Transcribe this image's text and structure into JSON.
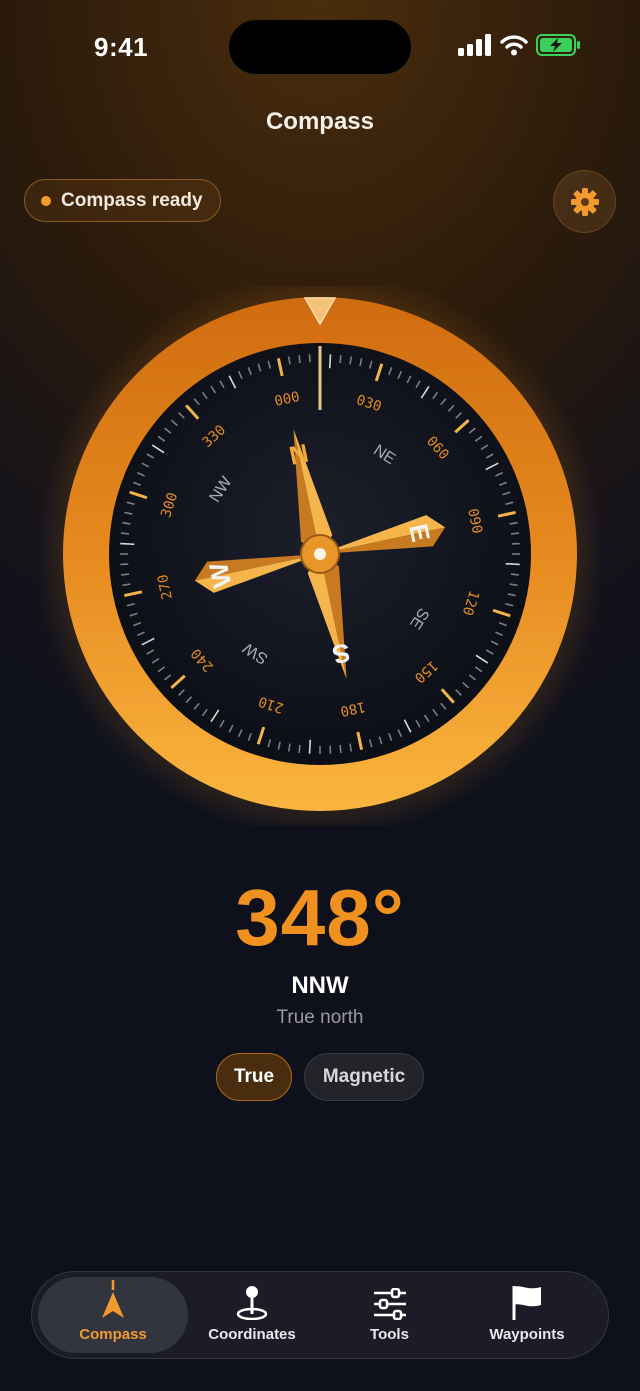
{
  "status_bar": {
    "time": "9:41"
  },
  "header": {
    "title": "Compass"
  },
  "status_pill": {
    "label": "Compass ready",
    "dot_color": "#f39c2b"
  },
  "settings": {
    "icon": "gear-icon"
  },
  "compass": {
    "bezel_color": "#f0901f",
    "degree_labels": [
      "000",
      "030",
      "060",
      "090",
      "120",
      "150",
      "180",
      "210",
      "240",
      "270",
      "300",
      "330"
    ],
    "intercardinals": [
      "NE",
      "SE",
      "SW",
      "NW"
    ],
    "cardinals": [
      "N",
      "E",
      "S",
      "W"
    ]
  },
  "heading": {
    "value": "348°",
    "direction": "NNW",
    "reference": "True north"
  },
  "mode_toggle": {
    "true_label": "True",
    "magnetic_label": "Magnetic",
    "selected": "True"
  },
  "tab_bar": {
    "tabs": [
      {
        "label": "Compass",
        "icon": "compass-needle-icon",
        "active": true
      },
      {
        "label": "Coordinates",
        "icon": "map-pin-icon",
        "active": false
      },
      {
        "label": "Tools",
        "icon": "sliders-icon",
        "active": false
      },
      {
        "label": "Waypoints",
        "icon": "flag-icon",
        "active": false
      }
    ]
  },
  "accent_color": "#f0901f"
}
